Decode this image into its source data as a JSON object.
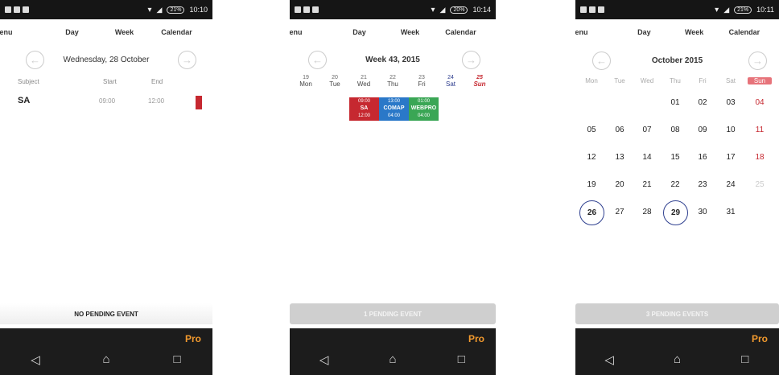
{
  "screens": [
    {
      "status": {
        "time": "10:10",
        "battery": "21%"
      },
      "tabs": [
        "Menu",
        "Day",
        "Week",
        "Calendar"
      ],
      "nav": {
        "title": "Wednesday, 28 October",
        "prev_icon": "left-arrow-icon",
        "next_icon": "right-arrow-icon"
      },
      "table": {
        "headers": [
          "Subject",
          "Start",
          "End"
        ],
        "rows": [
          {
            "subject": "SA",
            "start": "09:00",
            "end": "12:00",
            "color": "#c62830"
          }
        ]
      },
      "pending": "NO PENDING EVENT",
      "pro": "Pro"
    },
    {
      "status": {
        "time": "10:14",
        "battery": "20%"
      },
      "tabs": [
        "Menu",
        "Day",
        "Week",
        "Calendar"
      ],
      "nav": {
        "title": "Week 43, 2015"
      },
      "days": [
        {
          "num": "19",
          "name": "Mon"
        },
        {
          "num": "20",
          "name": "Tue"
        },
        {
          "num": "21",
          "name": "Wed"
        },
        {
          "num": "22",
          "name": "Thu"
        },
        {
          "num": "23",
          "name": "Fri"
        },
        {
          "num": "24",
          "name": "Sat"
        },
        {
          "num": "25",
          "name": "Sun"
        }
      ],
      "events": [
        {
          "title": "SA",
          "start": "09:00",
          "end": "12:00",
          "color": "#c62830"
        },
        {
          "title": "COMAP",
          "start": "13:00",
          "end": "04:00",
          "color": "#2a78c8"
        },
        {
          "title": "WEBPRO",
          "start": "01:00",
          "end": "04:00",
          "color": "#3aa655"
        }
      ],
      "pending": "1 PENDING EVENT",
      "pro": "Pro"
    },
    {
      "status": {
        "time": "10:11",
        "battery": "21%"
      },
      "tabs": [
        "Menu",
        "Day",
        "Week",
        "Calendar"
      ],
      "nav": {
        "title": "October 2015"
      },
      "weekdays": [
        "Mon",
        "Tue",
        "Wed",
        "Thu",
        "Fri",
        "Sat",
        "Sun"
      ],
      "weeks": [
        [
          "",
          "",
          "",
          "01",
          "02",
          "03",
          "04"
        ],
        [
          "05",
          "06",
          "07",
          "08",
          "09",
          "10",
          "11"
        ],
        [
          "12",
          "13",
          "14",
          "15",
          "16",
          "17",
          "18"
        ],
        [
          "19",
          "20",
          "21",
          "22",
          "23",
          "24",
          "25"
        ],
        [
          "26",
          "27",
          "28",
          "29",
          "30",
          "31",
          ""
        ]
      ],
      "circled": [
        "26",
        "29"
      ],
      "pending": "3 PENDING EVENTS",
      "pro": "Pro"
    }
  ],
  "colors": {
    "accent_red": "#c62830",
    "accent_blue": "#2e3f8f",
    "pro_orange": "#f29a2e"
  }
}
